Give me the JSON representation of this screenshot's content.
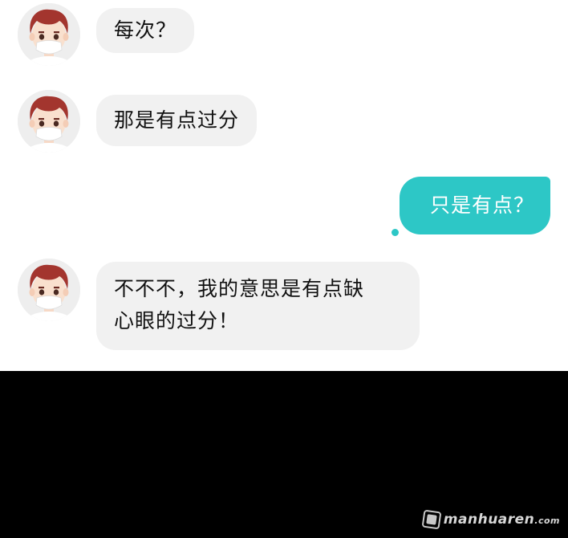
{
  "messages": [
    {
      "sender": "other",
      "text": "每次？"
    },
    {
      "sender": "other",
      "text": "那是有点过分"
    },
    {
      "sender": "me",
      "text": "只是有点？"
    },
    {
      "sender": "other",
      "lines": [
        "不不不，我的意思是有点缺",
        "心眼的过分！"
      ]
    }
  ],
  "watermark": {
    "name": "manhuaren",
    "tld": ".com"
  },
  "colors": {
    "incoming_bubble": "#f1f1f1",
    "outgoing_bubble": "#2dc7c6",
    "panel_background": "#ffffff",
    "page_background": "#000000"
  }
}
